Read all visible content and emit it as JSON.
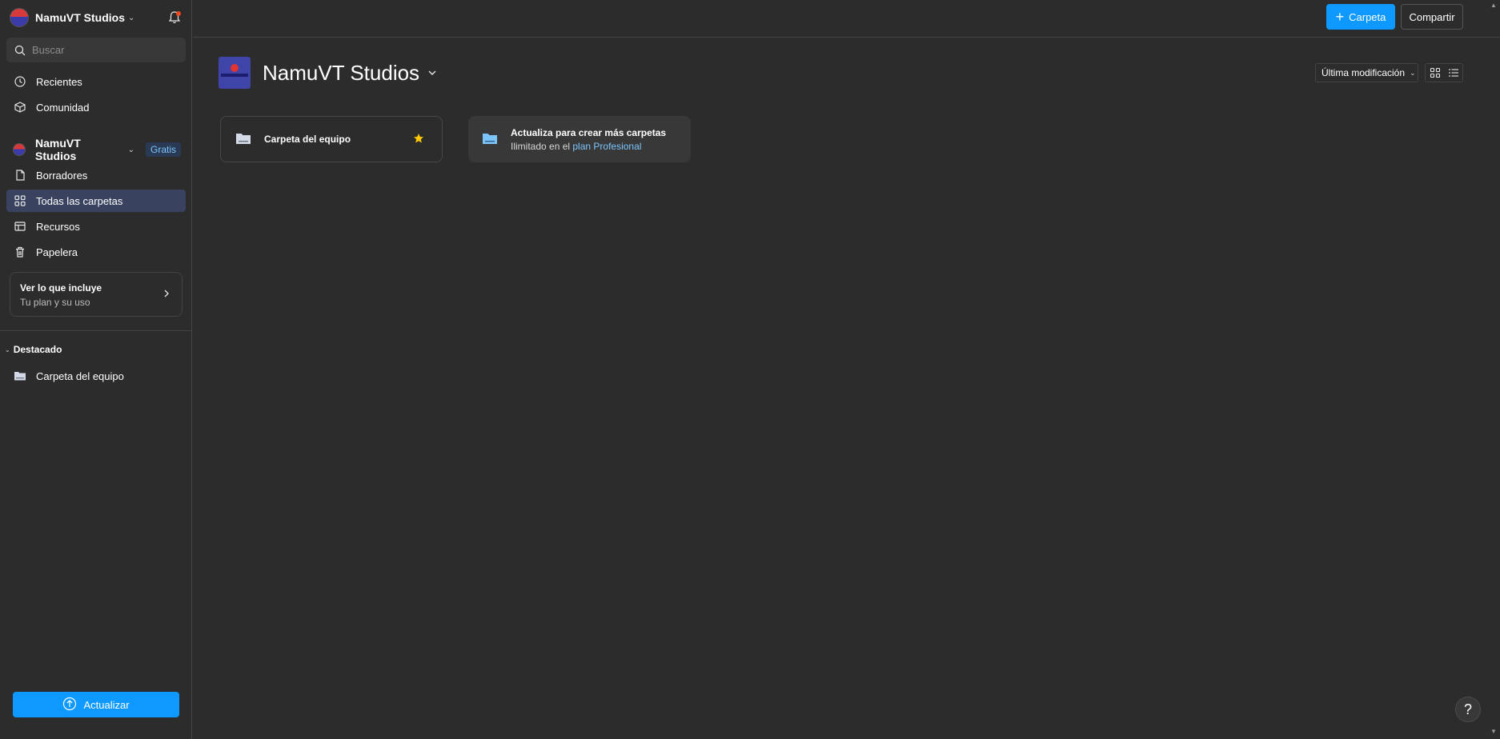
{
  "sidebar": {
    "team_name": "NamuVT Studios",
    "search_placeholder": "Buscar",
    "nav_top": [
      {
        "label": "Recientes",
        "icon": "clock-icon"
      },
      {
        "label": "Comunidad",
        "icon": "cube-icon"
      }
    ],
    "team_section": {
      "name": "NamuVT Studios",
      "badge": "Gratis",
      "items": [
        {
          "label": "Borradores",
          "icon": "file-icon"
        },
        {
          "label": "Todas las carpetas",
          "icon": "grid-icon",
          "active": true
        },
        {
          "label": "Recursos",
          "icon": "resources-icon"
        },
        {
          "label": "Papelera",
          "icon": "trash-icon"
        }
      ]
    },
    "plan_card": {
      "title": "Ver lo que incluye",
      "subtitle": "Tu plan y su uso"
    },
    "starred": {
      "title": "Destacado",
      "items": [
        {
          "label": "Carpeta del equipo",
          "icon": "folder-icon"
        }
      ]
    },
    "update_label": "Actualizar"
  },
  "topbar": {
    "new_folder_label": "Carpeta",
    "share_label": "Compartir"
  },
  "main": {
    "title": "NamuVT Studios",
    "sort_label": "Última modificación",
    "folders": [
      {
        "name": "Carpeta del equipo",
        "starred": true
      }
    ],
    "upgrade": {
      "title": "Actualiza para crear más carpetas",
      "text_prefix": "Ilimitado en el ",
      "link": "plan Profesional"
    }
  },
  "help_label": "?",
  "colors": {
    "background": "#2c2c2c",
    "accent": "#0d99ff",
    "active_nav": "#394360",
    "link": "#7cc4fa",
    "star": "#ffc700"
  }
}
